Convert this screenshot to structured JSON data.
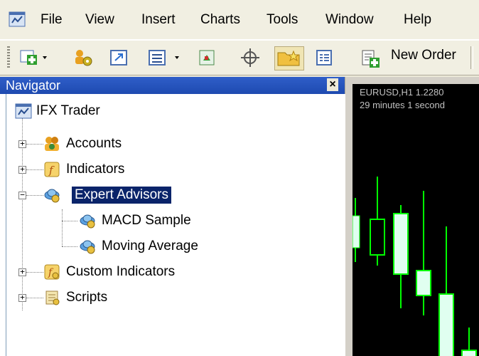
{
  "menubar": {
    "items": [
      "File",
      "View",
      "Insert",
      "Charts",
      "Tools",
      "Window",
      "Help"
    ]
  },
  "toolbar": {
    "new_order_label": "New Order"
  },
  "navigator": {
    "title": "Navigator",
    "close_glyph": "×",
    "root": "IFX Trader",
    "nodes": {
      "accounts": "Accounts",
      "indicators": "Indicators",
      "expert_advisors": "Expert Advisors",
      "macd_sample": "MACD Sample",
      "moving_average": "Moving Average",
      "custom_indicators": "Custom Indicators",
      "scripts": "Scripts"
    }
  },
  "chart": {
    "symbol_line": "EURUSD,H1  1.2280",
    "timer_line": "29 minutes 1 second"
  }
}
